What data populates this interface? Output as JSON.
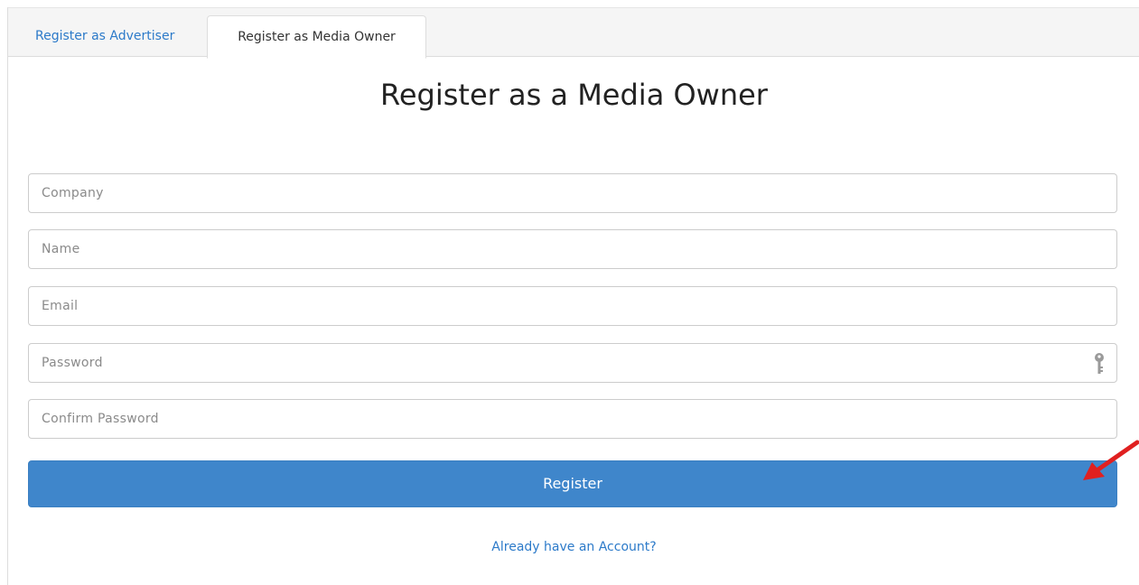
{
  "tabs": {
    "advertiser_label": "Register as Advertiser",
    "media_owner_label": "Register as Media Owner",
    "active": "media_owner"
  },
  "page": {
    "title": "Register as a Media Owner"
  },
  "form": {
    "company_placeholder": "Company",
    "name_placeholder": "Name",
    "email_placeholder": "Email",
    "password_placeholder": "Password",
    "confirm_password_placeholder": "Confirm Password",
    "password_icon": "key-icon",
    "register_label": "Register",
    "account_link": "Already have an Account?"
  },
  "colors": {
    "accent": "#3f86cb",
    "link": "#2c7ac9",
    "annotation_arrow": "#e02020"
  }
}
